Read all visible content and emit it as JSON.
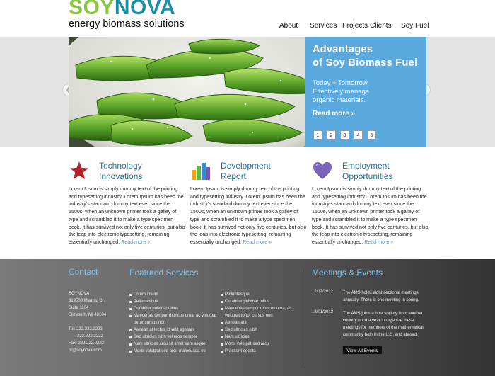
{
  "brand": {
    "logo_soy": "SOY",
    "logo_nova": "NOVA",
    "tagline": "energy biomass solutions",
    "color_green": "#8dc63f",
    "color_blue": "#1f8fa8"
  },
  "nav": {
    "items": [
      "About",
      "Services",
      "Projects",
      "Clients",
      "Soy Fuel"
    ]
  },
  "slider": {
    "image_subject": "edamame soybean pods in white bowl",
    "title_line1": "Advantages",
    "title_line2": "of Soy Biomass Fuel",
    "text_line1": "Today + Tomorrow",
    "text_line2": "Effectively manage",
    "text_line3": "organic materials.",
    "more": "Read more »",
    "pages": [
      "1",
      "2",
      "3",
      "4",
      "5"
    ],
    "prev_icon": "chevron-left-icon",
    "next_icon": "chevron-right-icon",
    "panel_color": "#5aa9df"
  },
  "features": [
    {
      "icon": "star-icon",
      "title_line1": "Technology",
      "title_line2": "Innovations",
      "body": "Lorem Ipsum is simply dummy text of the printing and typesetting industry. Lorem Ipsum has been the industry's standard dummy text ever since the 1500s, when an unknown printer took a galley of type and scrambled it to make a type specimen book. It has survived not only five centuries, but also the leap into electronic typesetting, remaining essentially unchanged.",
      "more": "Read more »"
    },
    {
      "icon": "bar-chart-icon",
      "title_line1": "Development",
      "title_line2": "Report",
      "body": "Lorem Ipsum is simply dummy text of the printing and typesetting industry. Lorem Ipsum has been the industry's standard dummy text ever since the 1500s, when an unknown printer took a galley of type and scrambled it to make a type specimen book. It has survived not only five centuries, but also the leap into electronic typesetting, remaining essentially unchanged.",
      "more": "Read more »"
    },
    {
      "icon": "heart-icon",
      "title_line1": "Employment",
      "title_line2": "Opportunities",
      "body": "Lorem Ipsum is simply dummy text of the printing and typesetting industry. Lorem Ipsum has been the industry's standard dummy text ever since the 1500s, when an unknown printer took a galley of type and scrambled it to make a type specimen book. It has survived not only five centuries, but also the leap into electronic typesetting, remaining essentially unchanged.",
      "more": "Read more »"
    }
  ],
  "footer": {
    "contact": {
      "heading": "Contact",
      "name": "SOYNOVA",
      "addr1": "319500  Marditu Dr.",
      "addr2": "Suite 1104",
      "addr3": "Elizabeth,  MI   48104",
      "tel": "Tel: 222.222.2222",
      "tel2": "222.222.2222",
      "fax": "Fax: 222.222.2222",
      "email": "hr@soynova.com"
    },
    "services": {
      "heading": "Featured Services",
      "col1": [
        "Lorem ipsum",
        "Pellentesque",
        "Curabitur pulvinar tellus",
        "Maecenas tempor rhoncus urna, ac volutpat tortor cursus non",
        "Aenean at lectus id velit egestas",
        "Sed ultricies nibh vel eros semper",
        "Nam ultricies arcu sit amet sem aliquet",
        "Morbi volutpat sed arcu malesuada eu"
      ],
      "col2": [
        "Pellentesque",
        "Curabitur pulvinar tellus",
        "Maecenas tempor rhoncus urna, ac volutpat tortor cursus non",
        "Aenean at lr",
        "Sed ultricies nibh",
        "Nam ultricies",
        "Morbi volutpat sed arcu",
        "Praesent egesta"
      ]
    },
    "events": {
      "heading": "Meetings & Events",
      "items": [
        {
          "date": "12/12/2012",
          "text": "The AMS holds eight sectional meetings annually. There is one meeting in spring."
        },
        {
          "date": "18/01/2013",
          "text": "The AMS joins a host society from another country once a year to organize these meetings for members of the mathematical community both in the U.S. and abroad."
        }
      ],
      "button": "View All Events"
    },
    "heading_color": "#7ec3ea"
  }
}
